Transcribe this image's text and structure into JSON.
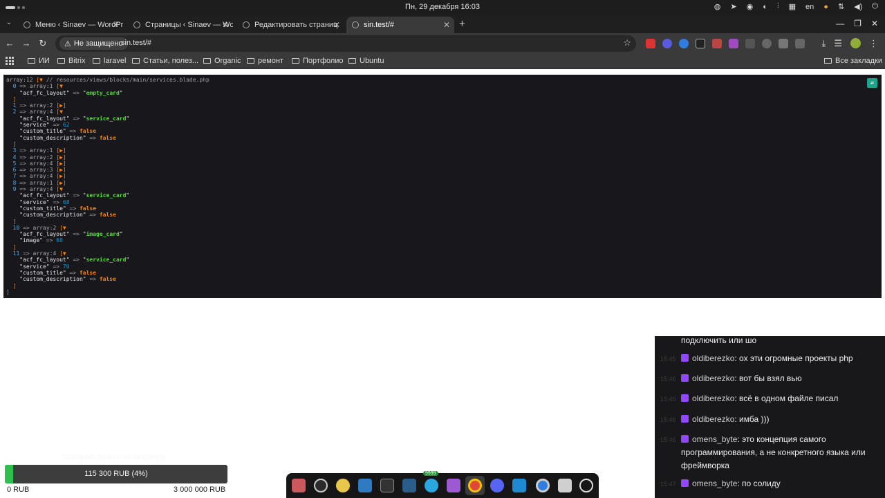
{
  "system_bar": {
    "clock": "Пн, 29 декабря 16:03",
    "lang": "en"
  },
  "tabs": [
    {
      "title": "Меню ‹ Sinaev — WordPr",
      "active": false
    },
    {
      "title": "Страницы ‹ Sinaev — Wo",
      "active": false
    },
    {
      "title": "Редактировать страниц",
      "active": false
    },
    {
      "title": "sin.test/#",
      "active": true
    }
  ],
  "toolbar": {
    "security_label": "Не защищено",
    "url": "sin.test/#"
  },
  "bookmarks": {
    "items": [
      "ИИ",
      "Bitrix",
      "laravel",
      "Статьи, полез...",
      "Organic",
      "ремонт",
      "Портфолио",
      "Ubuntu"
    ],
    "all_bookmarks": "Все закладки"
  },
  "dump": {
    "lines": [
      [
        [
          "k-arr",
          "array:12 "
        ],
        [
          "k-brk",
          "[▼ "
        ],
        [
          "k-gray",
          "// resources/views/blocks/main/services.blade.php"
        ]
      ],
      [
        [
          "",
          "  "
        ],
        [
          "k-blue",
          "0"
        ],
        [
          "k-gray",
          " => "
        ],
        [
          "k-arr",
          "array:1 "
        ],
        [
          "k-brk",
          "[▼"
        ]
      ],
      [
        [
          "",
          "    "
        ],
        [
          "k-key",
          "\"acf_fc_layout\""
        ],
        [
          "k-gray",
          " => "
        ],
        [
          "k-key",
          "\""
        ],
        [
          "k-str",
          "empty_card"
        ],
        [
          "k-key",
          "\""
        ]
      ],
      [
        [
          "",
          "  "
        ],
        [
          "k-brk",
          "]"
        ]
      ],
      [
        [
          "",
          "  "
        ],
        [
          "k-blue",
          "1"
        ],
        [
          "k-gray",
          " => "
        ],
        [
          "k-arr",
          "array:2 "
        ],
        [
          "k-brk",
          "[▶]"
        ]
      ],
      [
        [
          "",
          "  "
        ],
        [
          "k-blue",
          "2"
        ],
        [
          "k-gray",
          " => "
        ],
        [
          "k-arr",
          "array:4 "
        ],
        [
          "k-brk",
          "[▼"
        ]
      ],
      [
        [
          "",
          "    "
        ],
        [
          "k-key",
          "\"acf_fc_layout\""
        ],
        [
          "k-gray",
          " => "
        ],
        [
          "k-key",
          "\""
        ],
        [
          "k-str",
          "service_card"
        ],
        [
          "k-key",
          "\""
        ]
      ],
      [
        [
          "",
          "    "
        ],
        [
          "k-key",
          "\"service\""
        ],
        [
          "k-gray",
          " => "
        ],
        [
          "k-num",
          "62"
        ]
      ],
      [
        [
          "",
          "    "
        ],
        [
          "k-key",
          "\"custom_title\""
        ],
        [
          "k-gray",
          " => "
        ],
        [
          "k-bool",
          "false"
        ]
      ],
      [
        [
          "",
          "    "
        ],
        [
          "k-key",
          "\"custom_description\""
        ],
        [
          "k-gray",
          " => "
        ],
        [
          "k-bool",
          "false"
        ]
      ],
      [
        [
          "",
          "  "
        ],
        [
          "k-brk",
          "]"
        ]
      ],
      [
        [
          "",
          "  "
        ],
        [
          "k-blue",
          "3"
        ],
        [
          "k-gray",
          " => "
        ],
        [
          "k-arr",
          "array:1 "
        ],
        [
          "k-brk",
          "[▶]"
        ]
      ],
      [
        [
          "",
          "  "
        ],
        [
          "k-blue",
          "4"
        ],
        [
          "k-gray",
          " => "
        ],
        [
          "k-arr",
          "array:2 "
        ],
        [
          "k-brk",
          "[▶]"
        ]
      ],
      [
        [
          "",
          "  "
        ],
        [
          "k-blue",
          "5"
        ],
        [
          "k-gray",
          " => "
        ],
        [
          "k-arr",
          "array:4 "
        ],
        [
          "k-brk",
          "[▶]"
        ]
      ],
      [
        [
          "",
          "  "
        ],
        [
          "k-blue",
          "6"
        ],
        [
          "k-gray",
          " => "
        ],
        [
          "k-arr",
          "array:3 "
        ],
        [
          "k-brk",
          "[▶]"
        ]
      ],
      [
        [
          "",
          "  "
        ],
        [
          "k-blue",
          "7"
        ],
        [
          "k-gray",
          " => "
        ],
        [
          "k-arr",
          "array:4 "
        ],
        [
          "k-brk",
          "[▶]"
        ]
      ],
      [
        [
          "",
          "  "
        ],
        [
          "k-blue",
          "8"
        ],
        [
          "k-gray",
          " => "
        ],
        [
          "k-arr",
          "array:1 "
        ],
        [
          "k-brk",
          "[▶]"
        ]
      ],
      [
        [
          "",
          "  "
        ],
        [
          "k-blue",
          "9"
        ],
        [
          "k-gray",
          " => "
        ],
        [
          "k-arr",
          "array:4 "
        ],
        [
          "k-brk",
          "[▼"
        ]
      ],
      [
        [
          "",
          "    "
        ],
        [
          "k-key",
          "\"acf_fc_layout\""
        ],
        [
          "k-gray",
          " => "
        ],
        [
          "k-key",
          "\""
        ],
        [
          "k-str",
          "service_card"
        ],
        [
          "k-key",
          "\""
        ]
      ],
      [
        [
          "",
          "    "
        ],
        [
          "k-key",
          "\"service\""
        ],
        [
          "k-gray",
          " => "
        ],
        [
          "k-num",
          "68"
        ]
      ],
      [
        [
          "",
          "    "
        ],
        [
          "k-key",
          "\"custom_title\""
        ],
        [
          "k-gray",
          " => "
        ],
        [
          "k-bool",
          "false"
        ]
      ],
      [
        [
          "",
          "    "
        ],
        [
          "k-key",
          "\"custom_description\""
        ],
        [
          "k-gray",
          " => "
        ],
        [
          "k-bool",
          "false"
        ]
      ],
      [
        [
          "",
          "  "
        ],
        [
          "k-brk",
          "]"
        ]
      ],
      [
        [
          "",
          "  "
        ],
        [
          "k-blue",
          "10"
        ],
        [
          "k-gray",
          " => "
        ],
        [
          "k-arr",
          "array:2 "
        ],
        [
          "k-brk",
          "[▼"
        ]
      ],
      [
        [
          "",
          "    "
        ],
        [
          "k-key",
          "\"acf_fc_layout\""
        ],
        [
          "k-gray",
          " => "
        ],
        [
          "k-key",
          "\""
        ],
        [
          "k-str",
          "image_card"
        ],
        [
          "k-key",
          "\""
        ]
      ],
      [
        [
          "",
          "    "
        ],
        [
          "k-key",
          "\"image\""
        ],
        [
          "k-gray",
          " => "
        ],
        [
          "k-num",
          "60"
        ]
      ],
      [
        [
          "",
          "  "
        ],
        [
          "k-brk",
          "]"
        ]
      ],
      [
        [
          "",
          "  "
        ],
        [
          "k-blue",
          "11"
        ],
        [
          "k-gray",
          " => "
        ],
        [
          "k-arr",
          "array:4 "
        ],
        [
          "k-brk",
          "[▼"
        ]
      ],
      [
        [
          "",
          "    "
        ],
        [
          "k-key",
          "\"acf_fc_layout\""
        ],
        [
          "k-gray",
          " => "
        ],
        [
          "k-key",
          "\""
        ],
        [
          "k-str",
          "service_card"
        ],
        [
          "k-key",
          "\""
        ]
      ],
      [
        [
          "",
          "    "
        ],
        [
          "k-key",
          "\"service\""
        ],
        [
          "k-gray",
          " => "
        ],
        [
          "k-num",
          "70"
        ]
      ],
      [
        [
          "",
          "    "
        ],
        [
          "k-key",
          "\"custom_title\""
        ],
        [
          "k-gray",
          " => "
        ],
        [
          "k-bool",
          "false"
        ]
      ],
      [
        [
          "",
          "    "
        ],
        [
          "k-key",
          "\"custom_description\""
        ],
        [
          "k-gray",
          " => "
        ],
        [
          "k-bool",
          "false"
        ]
      ],
      [
        [
          "",
          "  "
        ],
        [
          "k-brk",
          "]"
        ]
      ],
      [
        [
          "k-brk",
          "]"
        ]
      ]
    ]
  },
  "chat": {
    "messages": [
      {
        "time": "",
        "user": "",
        "text": "подключить или шо"
      },
      {
        "time": "15:45",
        "user": "oldiberezko",
        "text": "ох эти огромные проекты php"
      },
      {
        "time": "15:46",
        "user": "oldiberezko",
        "text": "вот бы взял вью"
      },
      {
        "time": "15:46",
        "user": "oldiberezko",
        "text": "всё в одном файле писал"
      },
      {
        "time": "15:48",
        "user": "oldiberezko",
        "text": "имба )))"
      },
      {
        "time": "15:46",
        "user": "omens_byte",
        "text": "это концепция самого программирования, а не конкретного языка или фреймворка"
      },
      {
        "time": "15:47",
        "user": "omens_byte",
        "text": "по солиду"
      }
    ]
  },
  "donation": {
    "title": "Собираю деньги на квартиру",
    "progress_text": "115 300 RUB (4%)",
    "progress_fraction": 0.0384,
    "min": "0 RUB",
    "max": "3 000 000 RUB",
    "color": "#2fbf4f"
  },
  "dock": {
    "badge": "9999"
  }
}
